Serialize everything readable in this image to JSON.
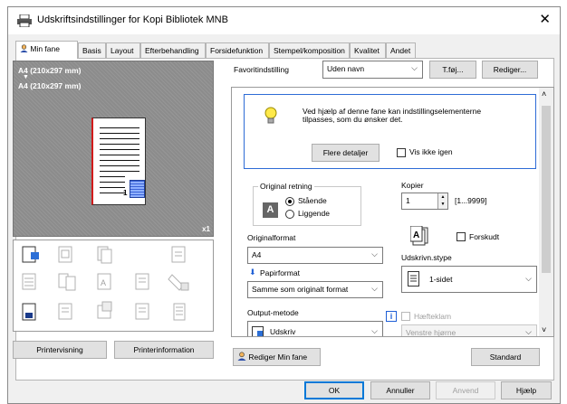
{
  "window": {
    "title": "Udskriftsindstillinger for Kopi Bibliotek MNB"
  },
  "tabs": [
    "Min fane",
    "Basis",
    "Layout",
    "Efterbehandling",
    "Forsidefunktion",
    "Stempel/komposition",
    "Kvalitet",
    "Andet"
  ],
  "preview": {
    "paper_label_top": "A4 (210x297 mm)",
    "paper_label_bottom": "A4 (210x297 mm)",
    "copies_badge": "x1"
  },
  "favorites": {
    "label": "Favoritindstilling",
    "value": "Uden navn",
    "add_button": "T.føj...",
    "edit_button": "Rediger..."
  },
  "info": {
    "message_line1": "Ved hjælp af denne fane kan indstillingselementerne",
    "message_line2": "tilpasses, som du ønsker det.",
    "details_button": "Flere detaljer",
    "hide_label": "Vis ikke igen"
  },
  "orientation": {
    "legend": "Original retning",
    "portrait": "Stående",
    "landscape": "Liggende",
    "icon_letter": "A"
  },
  "copies": {
    "label": "Kopier",
    "value": "1",
    "range": "[1...9999]",
    "collate_label": "Forskudt"
  },
  "original_size": {
    "label": "Originalformat",
    "value": "A4"
  },
  "paper_size": {
    "label": "Papirformat",
    "value": "Samme som originalt format"
  },
  "print_type": {
    "label": "Udskrivn.stype",
    "value": "1-sidet"
  },
  "output_method": {
    "label": "Output-metode",
    "value": "Udskriv"
  },
  "staple": {
    "label": "Hæfteklam",
    "value": "Venstre hjørne"
  },
  "left_buttons": {
    "printer_view": "Printervisning",
    "printer_info": "Printerinformation"
  },
  "bottom": {
    "edit_tab": "Rediger Min fane",
    "standard": "Standard",
    "ok": "OK",
    "cancel": "Annuller",
    "apply": "Anvend",
    "help": "Hjælp"
  },
  "colors": {
    "accent": "#0078d7",
    "info_border": "#2d6bd6",
    "preview_bg": "#8c8c8c"
  }
}
